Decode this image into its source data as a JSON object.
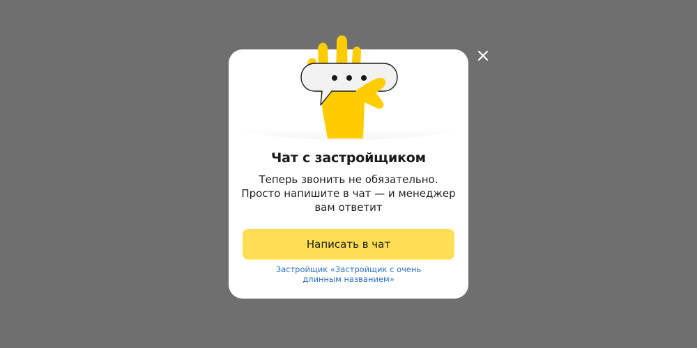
{
  "modal": {
    "title": "Чат с застройщиком",
    "description": "Теперь звонить не обязательно. Просто напишите в чат — и менеджер вам ответит",
    "button_label": "Написать в чат",
    "developer_link": "Застройщик «Застройщик с очень длинным названием»",
    "illustration_icon": "hand-chat-bubble-icon",
    "close_icon": "close-icon"
  },
  "colors": {
    "overlay": "#6f6f6f",
    "accent": "#ffdd55",
    "hand": "#ffcc00",
    "link": "#2a6ed1"
  }
}
